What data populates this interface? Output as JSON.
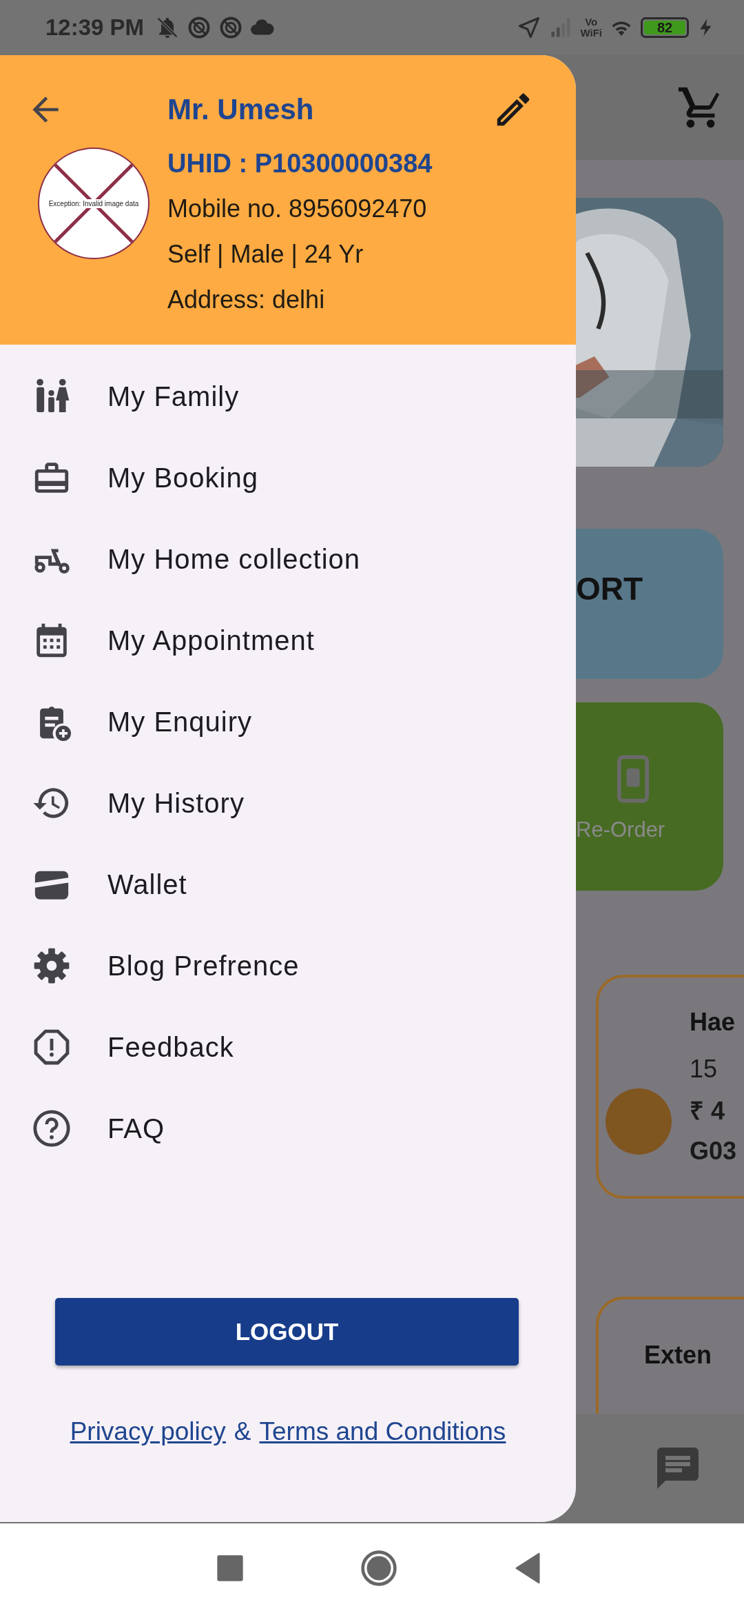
{
  "status_bar": {
    "time": "12:39 PM",
    "wifi_label": [
      "Vo",
      "WiFi"
    ],
    "battery": "82"
  },
  "drawer": {
    "user": {
      "name": "Mr. Umesh",
      "avatar_error": "Exception: Invalid image data",
      "uhid": "UHID : P10300000384",
      "mobile": "Mobile no. 8956092470",
      "details": "Self | Male | 24 Yr",
      "address": "Address: delhi"
    },
    "menu": [
      {
        "label": "My Family",
        "kind": "family"
      },
      {
        "label": "My Booking",
        "kind": "briefcase"
      },
      {
        "label": "My Home collection",
        "kind": "scooter"
      },
      {
        "label": "My Appointment",
        "kind": "calendar"
      },
      {
        "label": "My Enquiry",
        "kind": "clipboard"
      },
      {
        "label": "My History",
        "kind": "history"
      },
      {
        "label": "Wallet",
        "kind": "wallet"
      },
      {
        "label": "Blog Prefrence",
        "kind": "gear"
      },
      {
        "label": "Feedback",
        "kind": "alert"
      },
      {
        "label": "FAQ",
        "kind": "help"
      }
    ],
    "logout_button": "LOGOUT",
    "links": [
      {
        "label": "Privacy policy"
      },
      {
        "label": "Terms and Conditions"
      }
    ],
    "links_separator": "&"
  },
  "background": {
    "banner_text": "ORT",
    "reorder_label": "Re-Order",
    "tests": [
      {
        "title": "Hae",
        "lines": [
          "15",
          "₹ 4",
          "G03"
        ]
      },
      {
        "title": "Exten"
      }
    ]
  }
}
